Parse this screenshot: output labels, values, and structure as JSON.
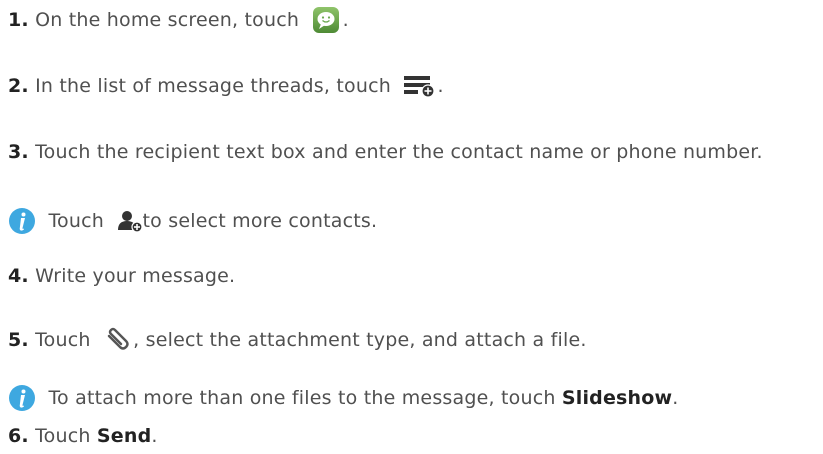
{
  "steps": [
    {
      "num": "1.",
      "text_a": "On the home screen, touch",
      "text_b": ".",
      "icon": "messaging-app-icon"
    },
    {
      "num": "2.",
      "text_a": "In the list of message threads, touch",
      "text_b": ".",
      "icon": "new-message-icon"
    },
    {
      "num": "3.",
      "text_a": "Touch the recipient text box and enter the contact name or phone number."
    },
    {
      "num": "4.",
      "text_a": "Write your message."
    },
    {
      "num": "5.",
      "text_a": "Touch",
      "text_b": ", select the attachment type, and attach a file.",
      "icon": "paperclip-icon"
    },
    {
      "num": "6.",
      "text_a": "Touch",
      "bold": "Send",
      "text_b": "."
    }
  ],
  "notes": [
    {
      "text_a": "Touch",
      "text_b": "to select more contacts.",
      "icon": "add-contact-icon"
    },
    {
      "text_a": "To attach more than one files to the message, touch",
      "bold": "Slideshow",
      "text_b": "."
    }
  ],
  "colors": {
    "number": "#222222",
    "text": "#505050",
    "info_blue": "#3ea8e0",
    "app_green": "#6aa84f"
  }
}
